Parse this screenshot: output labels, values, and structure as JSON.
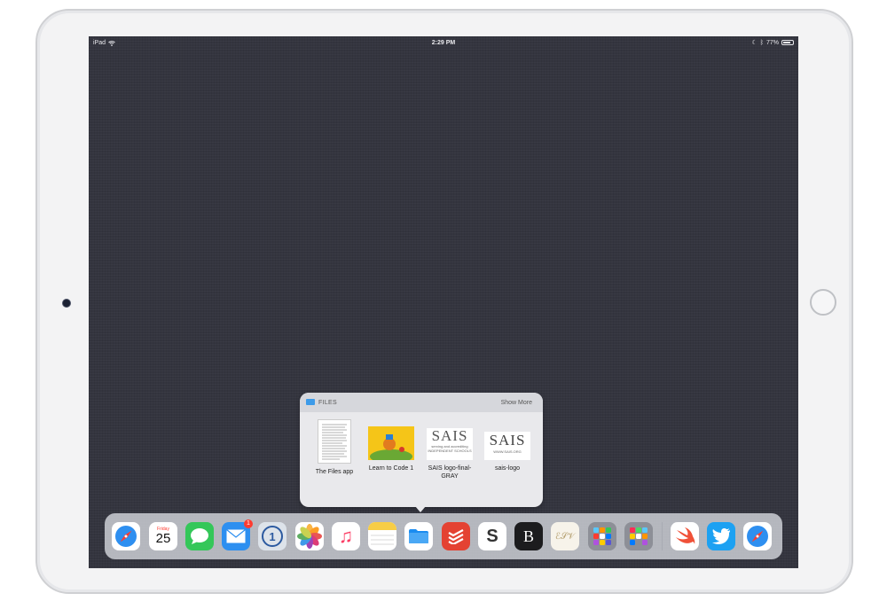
{
  "status_bar": {
    "device": "iPad",
    "time": "2:29 PM",
    "battery": "77%",
    "battery_level": 0.77
  },
  "files_popup": {
    "title": "FILES",
    "show_more": "Show More",
    "files": [
      {
        "name": "The Files app"
      },
      {
        "name": "Learn to Code 1"
      },
      {
        "name": "SAIS logo-final-GRAY",
        "logo_text": "SAIS",
        "tagline": "serving and accrediting",
        "tagline2": "INDEPENDENT SCHOOLS"
      },
      {
        "name": "sais-logo",
        "logo_text": "SAIS",
        "tagline": "WWW.SAIS.ORG"
      }
    ]
  },
  "dock": {
    "apps": [
      {
        "name": "safari-icon"
      },
      {
        "name": "calendar-icon",
        "day": "Friday",
        "date": "25"
      },
      {
        "name": "messages-icon"
      },
      {
        "name": "mail-icon",
        "badge": "1"
      },
      {
        "name": "1password-icon",
        "glyph": "1"
      },
      {
        "name": "photos-icon"
      },
      {
        "name": "music-icon",
        "glyph": "♫"
      },
      {
        "name": "notes-icon"
      },
      {
        "name": "files-icon"
      },
      {
        "name": "todoist-icon"
      },
      {
        "name": "slack-icon",
        "glyph": "S"
      },
      {
        "name": "bear-icon",
        "glyph": "B"
      },
      {
        "name": "monogram-icon",
        "glyph": "ℰ𝒮𝒱"
      },
      {
        "name": "folder-icon"
      },
      {
        "name": "folder-icon"
      },
      {
        "name": "swift-playgrounds-icon"
      },
      {
        "name": "twitter-icon"
      },
      {
        "name": "safari-icon"
      }
    ]
  },
  "colors": {
    "wallpaper": "#34353f",
    "files_blue": "#3d9be9",
    "badge": "#ff3b30"
  }
}
